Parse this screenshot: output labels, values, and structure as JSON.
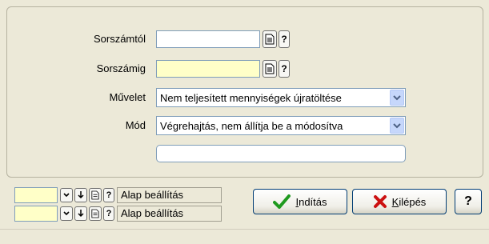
{
  "form": {
    "sorszamtol_label": "Sorszámtól",
    "sorszamtol_value": "",
    "sorszamig_label": "Sorszámig",
    "sorszamig_value": "",
    "muvelet_label": "Művelet",
    "muvelet_value": "Nem teljesített mennyiségek újratöltése",
    "mod_label": "Mód",
    "mod_value": "Végrehajtás, nem állítja be a módosítva",
    "extra_value": ""
  },
  "lookup": {
    "question_label": "?"
  },
  "presets": [
    {
      "label": "Alap beállítás",
      "value": ""
    },
    {
      "label": "Alap beállítás",
      "value": ""
    }
  ],
  "buttons": {
    "start_label_underlined": "I",
    "start_label_rest": "ndítás",
    "exit_label_underlined": "K",
    "exit_label_rest": "ilépés",
    "help_label": "?"
  },
  "colors": {
    "window_bg": "#ece9d8",
    "required_field_bg": "#ffffc8",
    "field_border": "#7f9db9",
    "check_green": "#1f9a1f",
    "exit_red": "#cc1111"
  }
}
